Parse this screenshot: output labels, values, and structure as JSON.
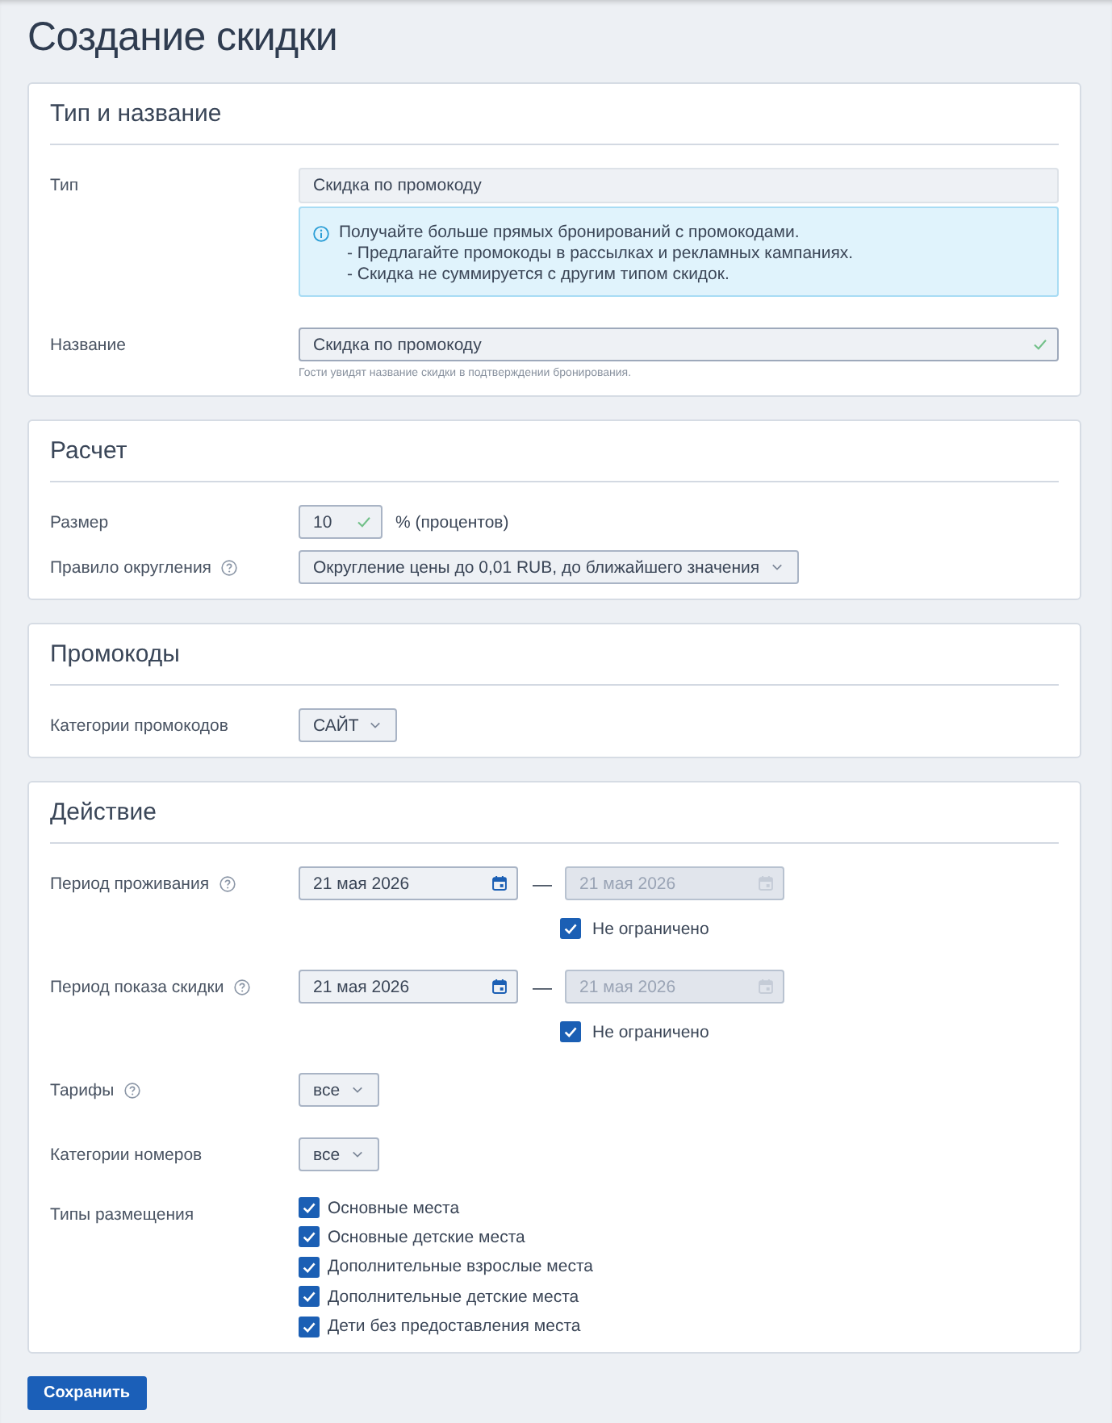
{
  "title": "Создание скидки",
  "sections": [
    {
      "title": "Тип и название",
      "rows": [
        {
          "kind": "readonly",
          "label": "Тип",
          "help": false,
          "value": "Скидка по промокоду",
          "info": {
            "lines": [
              "Получайте больше прямых бронирований с промокодами.",
              "- Предлагайте промокоды в рассылках и рекламных кампаниях.",
              "- Скидка не суммируется с другим типом скидок."
            ]
          }
        },
        {
          "kind": "text",
          "label": "Название",
          "help": false,
          "value": "Скидка по промокоду",
          "valid": true,
          "hint": "Гости увидят название скидки в подтверждении бронирования."
        }
      ]
    },
    {
      "title": "Расчет",
      "rows": [
        {
          "kind": "number",
          "label": "Размер",
          "help": false,
          "value": "10",
          "valid": true,
          "unit": "% (процентов)"
        },
        {
          "kind": "select",
          "label": "Правило округления",
          "help": true,
          "value": "Округление цены до 0,01 RUB, до ближайшего значения"
        }
      ]
    },
    {
      "title": "Промокоды",
      "rows": [
        {
          "kind": "select",
          "label": "Категории промокодов",
          "help": false,
          "value": "САЙТ"
        }
      ]
    },
    {
      "title": "Действие",
      "rows": [
        {
          "kind": "daterange",
          "label": "Период проживания",
          "help": true,
          "from": {
            "value": "21 мая 2026",
            "disabled": false
          },
          "separator": "—",
          "to": {
            "value": "21 мая 2026",
            "disabled": true
          },
          "unlimited": {
            "label": "Не ограничено",
            "checked": true
          }
        },
        {
          "kind": "daterange",
          "label": "Период показа скидки",
          "help": true,
          "from": {
            "value": "21 мая 2026",
            "disabled": false
          },
          "separator": "—",
          "to": {
            "value": "21 мая 2026",
            "disabled": true
          },
          "unlimited": {
            "label": "Не ограничено",
            "checked": true
          }
        },
        {
          "kind": "select",
          "label": "Тарифы",
          "help": true,
          "value": "все"
        },
        {
          "kind": "select",
          "label": "Категории номеров",
          "help": false,
          "value": "все"
        },
        {
          "kind": "checklist",
          "label": "Типы размещения",
          "help": false,
          "items": [
            {
              "label": "Основные места",
              "checked": true
            },
            {
              "label": "Основные детские места",
              "checked": true
            },
            {
              "label": "Дополнительные взрослые места",
              "checked": true
            },
            {
              "label": "Дополнительные детские места",
              "checked": true
            },
            {
              "label": "Дети без предоставления места",
              "checked": true
            }
          ]
        }
      ]
    }
  ],
  "save_button": {
    "label": "Сохранить"
  }
}
